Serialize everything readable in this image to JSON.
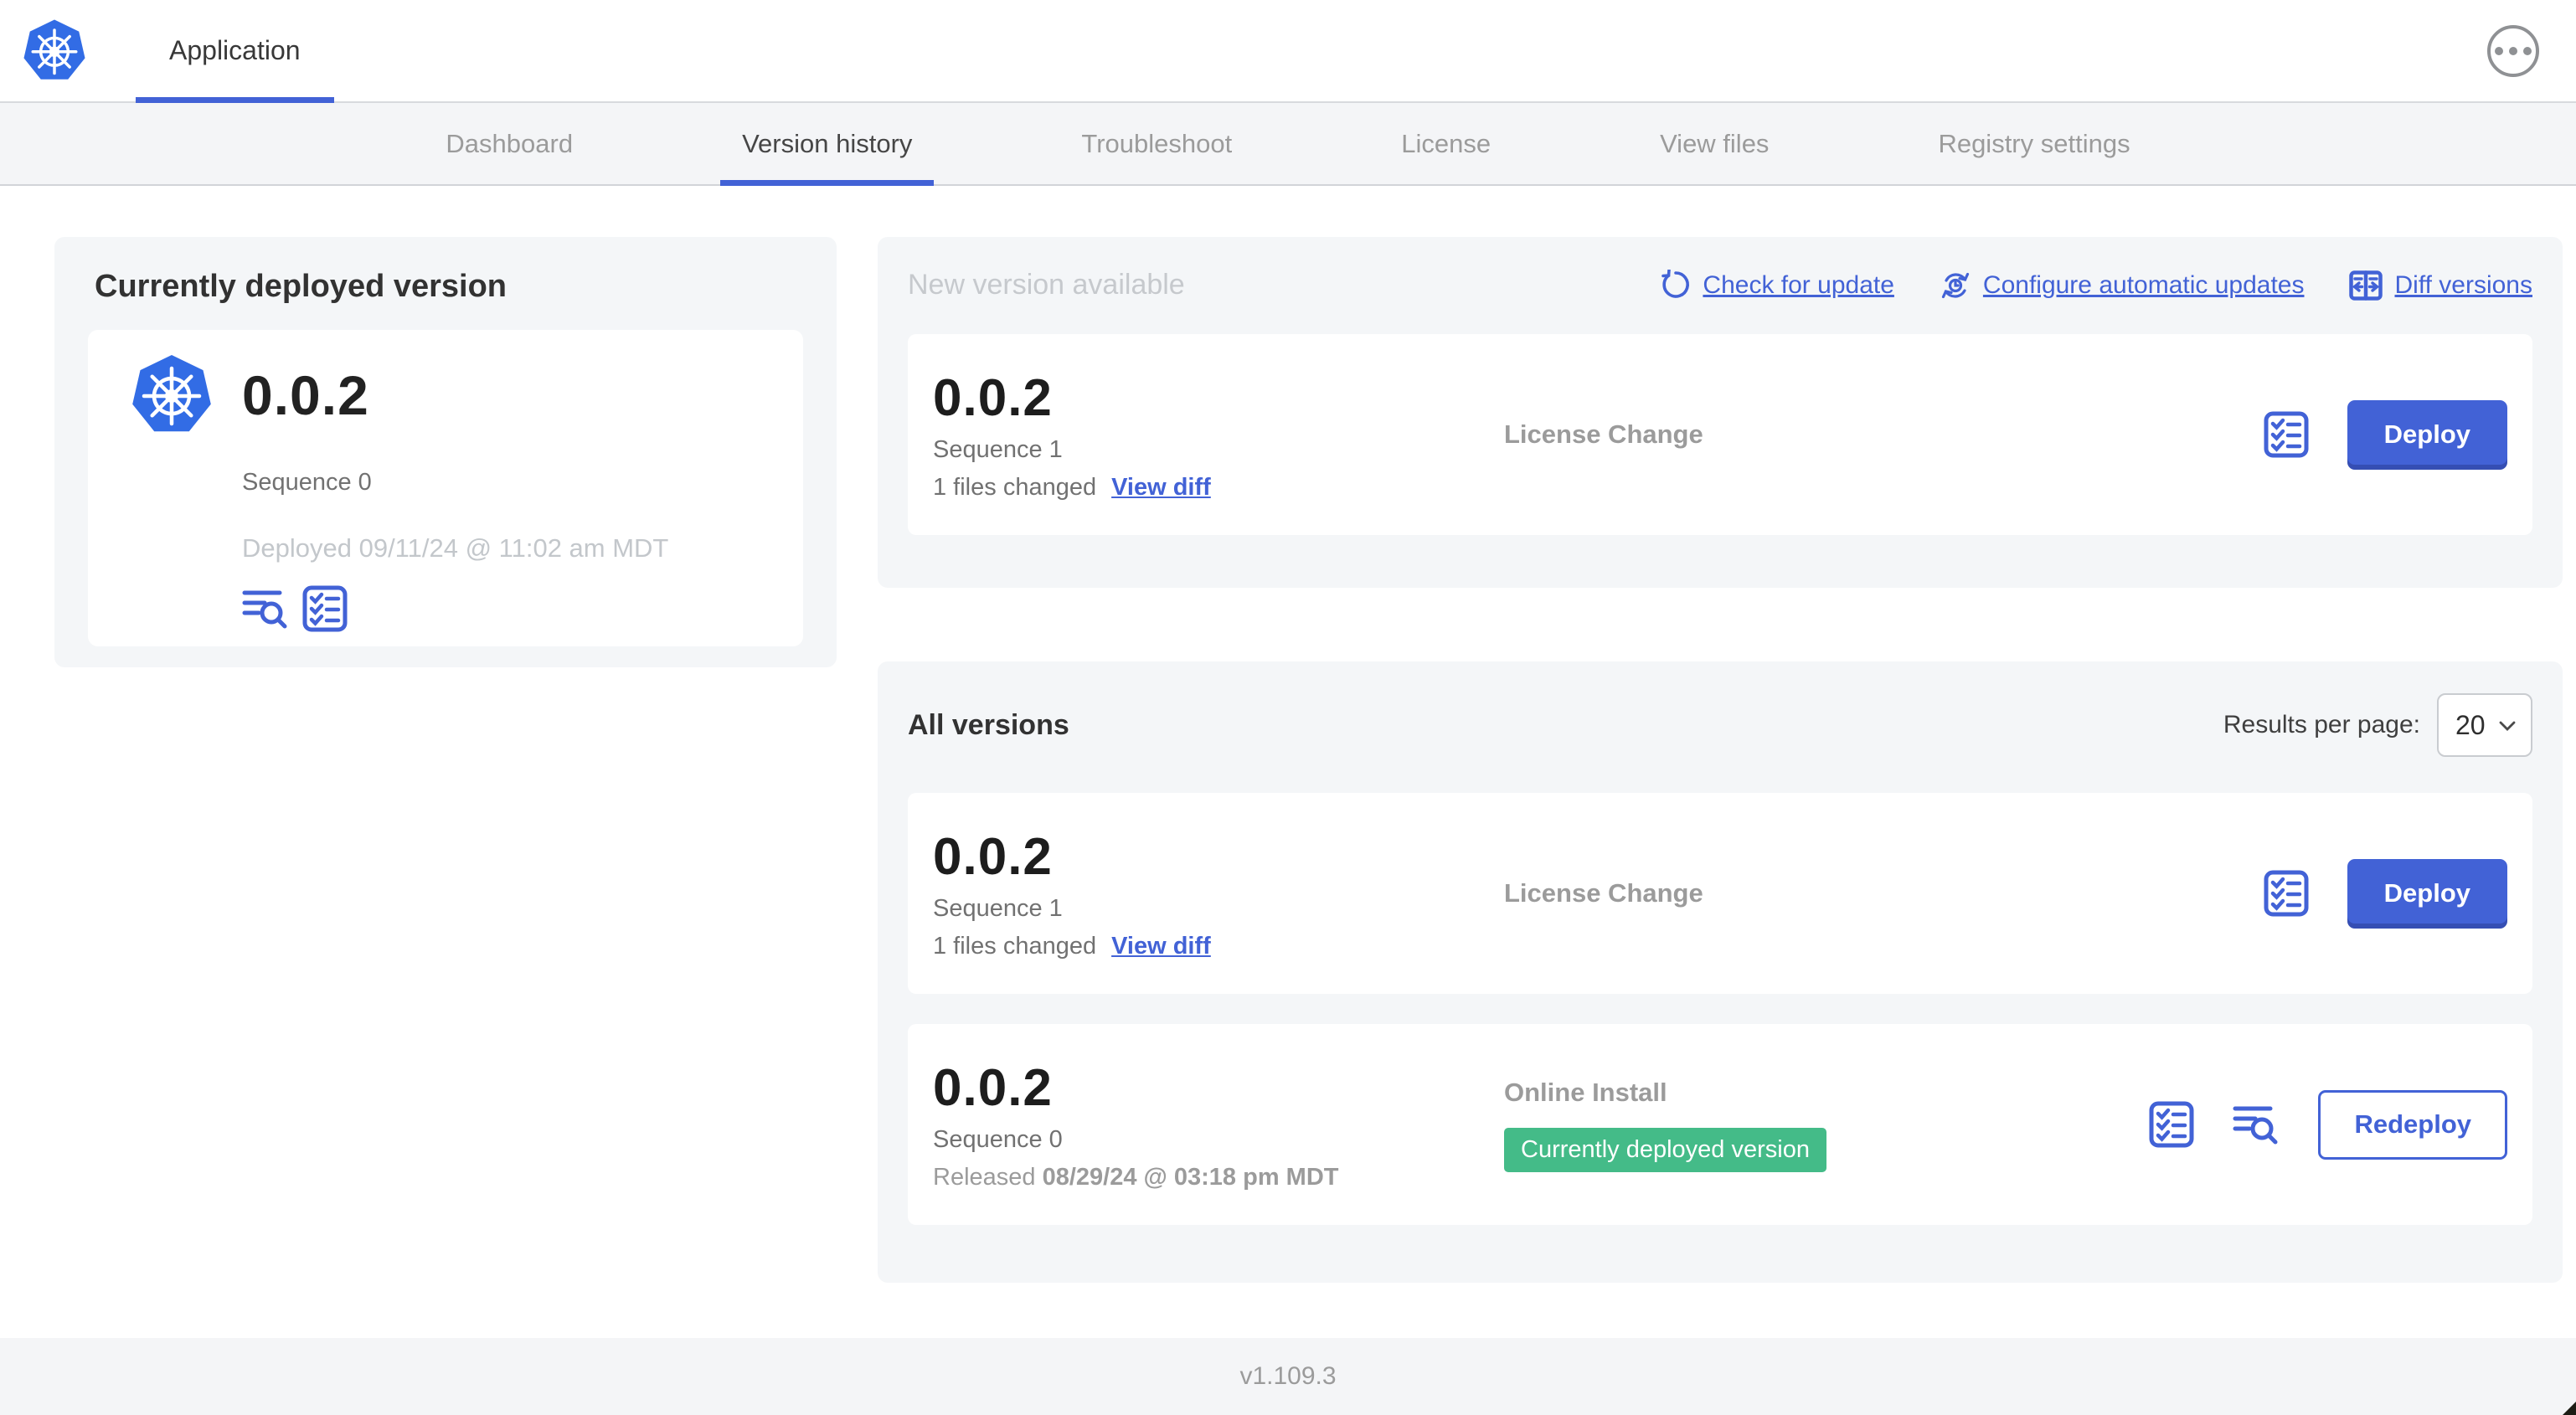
{
  "header": {
    "app_title": "Application"
  },
  "nav": {
    "tabs": [
      {
        "label": "Dashboard"
      },
      {
        "label": "Version history"
      },
      {
        "label": "Troubleshoot"
      },
      {
        "label": "License"
      },
      {
        "label": "View files"
      },
      {
        "label": "Registry settings"
      }
    ]
  },
  "current_version": {
    "title": "Currently deployed version",
    "version": "0.0.2",
    "sequence": "Sequence 0",
    "deployed": "Deployed 09/11/24 @ 11:02 am MDT"
  },
  "new_version": {
    "title": "New version available",
    "actions": {
      "check_for_update": "Check for update",
      "configure_automatic_updates": "Configure automatic updates",
      "diff_versions": "Diff versions"
    },
    "row": {
      "version": "0.0.2",
      "sequence": "Sequence 1",
      "files_changed": "1 files changed",
      "view_diff": "View diff",
      "source": "License Change",
      "deploy_label": "Deploy"
    }
  },
  "all_versions": {
    "title": "All versions",
    "results_per_page_label": "Results per page:",
    "results_per_page_value": "20",
    "rows": [
      {
        "version": "0.0.2",
        "sequence": "Sequence 1",
        "files_changed": "1 files changed",
        "view_diff": "View diff",
        "source": "License Change",
        "deploy_label": "Deploy"
      },
      {
        "version": "0.0.2",
        "sequence": "Sequence 0",
        "released_label": "Released",
        "released_date": "08/29/24 @ 03:18 pm MDT",
        "source": "Online Install",
        "badge": "Currently deployed version",
        "redeploy_label": "Redeploy"
      }
    ]
  },
  "footer": {
    "version_label": "v1.109.3"
  },
  "colors": {
    "accent_blue": "#4262d6",
    "kubernetes_blue": "#326ce5",
    "badge_green": "#44bb88",
    "card_background": "#f4f6f8",
    "muted_text": "#9b9b9b",
    "faint_text": "#c6c9cd"
  },
  "icons": {
    "app_logo": "kubernetes-wheel",
    "check_for_update": "refresh-arrow",
    "configure_automatic_updates": "auto-update-clock",
    "diff_versions": "diff-columns",
    "release_checks": "checklist",
    "view_logs": "lines-magnifier",
    "more_menu": "ellipsis-circle",
    "select": "chevron-down"
  }
}
